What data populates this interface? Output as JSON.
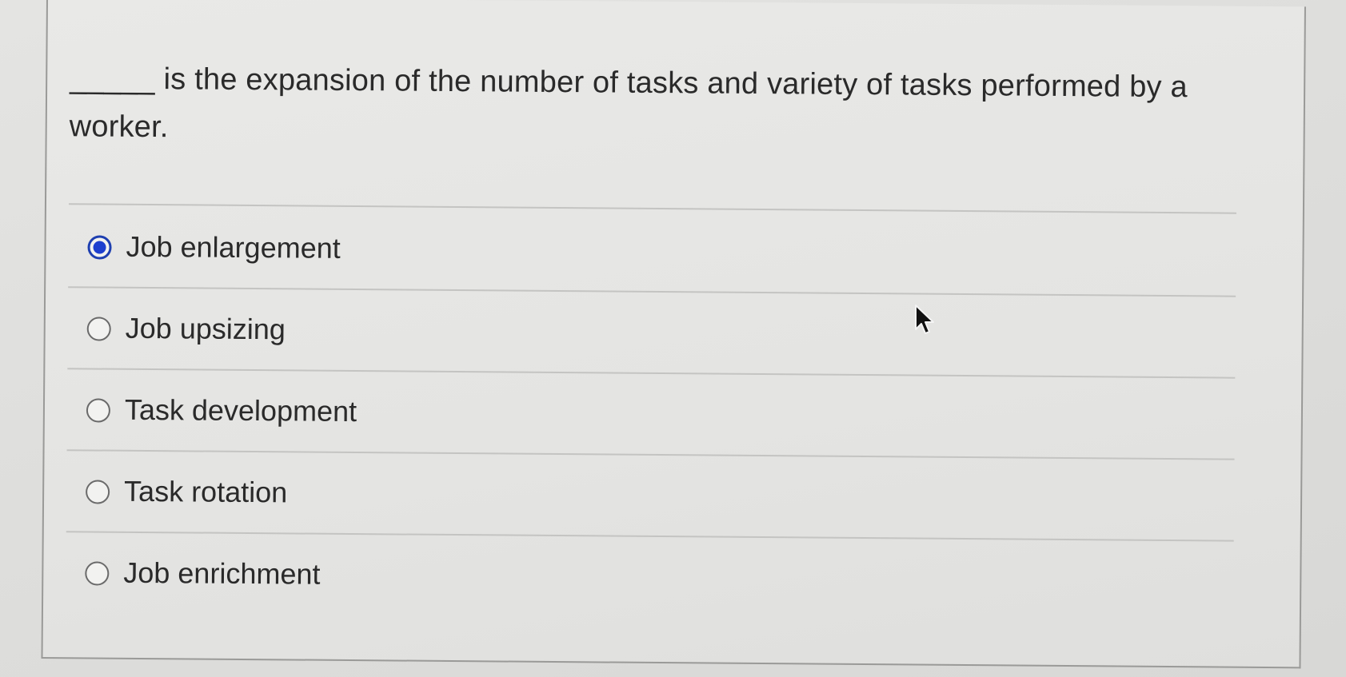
{
  "question": {
    "text": "_____ is the expansion of the number of tasks and variety of tasks performed by a worker."
  },
  "options": [
    {
      "label": "Job enlargement",
      "selected": true
    },
    {
      "label": "Job upsizing",
      "selected": false
    },
    {
      "label": "Task development",
      "selected": false
    },
    {
      "label": "Task rotation",
      "selected": false
    },
    {
      "label": "Job enrichment",
      "selected": false
    }
  ],
  "colors": {
    "radio_selected": "#1d3fcf",
    "text": "#2a2a2a",
    "divider": "#c4c4c2"
  },
  "icons": {
    "cursor": "mouse-pointer-icon"
  }
}
